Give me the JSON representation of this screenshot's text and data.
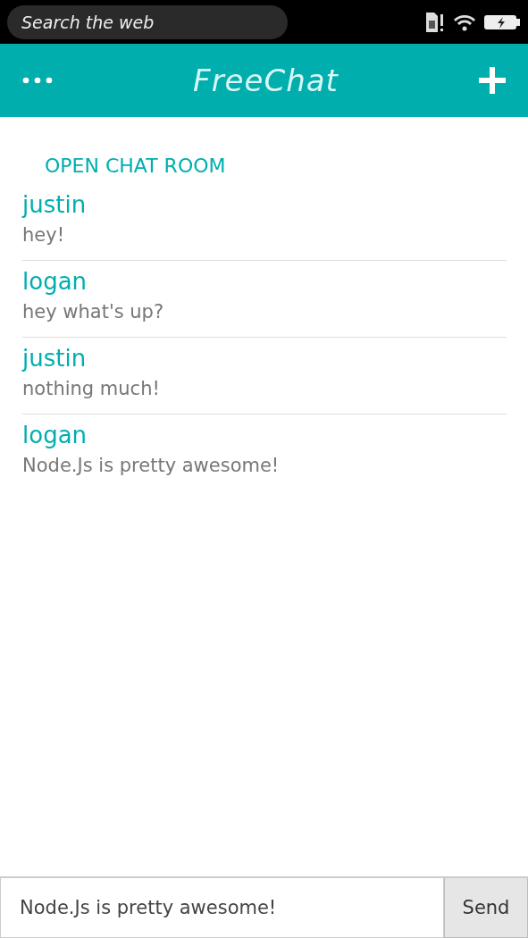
{
  "status_bar": {
    "search": {
      "placeholder": "Search the web"
    }
  },
  "header": {
    "title": "FreeChat"
  },
  "section_title": "OPEN CHAT ROOM",
  "messages": [
    {
      "user": "justin",
      "text": "hey!"
    },
    {
      "user": "logan",
      "text": "hey what's up?"
    },
    {
      "user": "justin",
      "text": "nothing much!"
    },
    {
      "user": "logan",
      "text": "Node.Js is pretty awesome!"
    }
  ],
  "composer": {
    "value": "Node.Js is pretty awesome!",
    "button": "Send"
  }
}
